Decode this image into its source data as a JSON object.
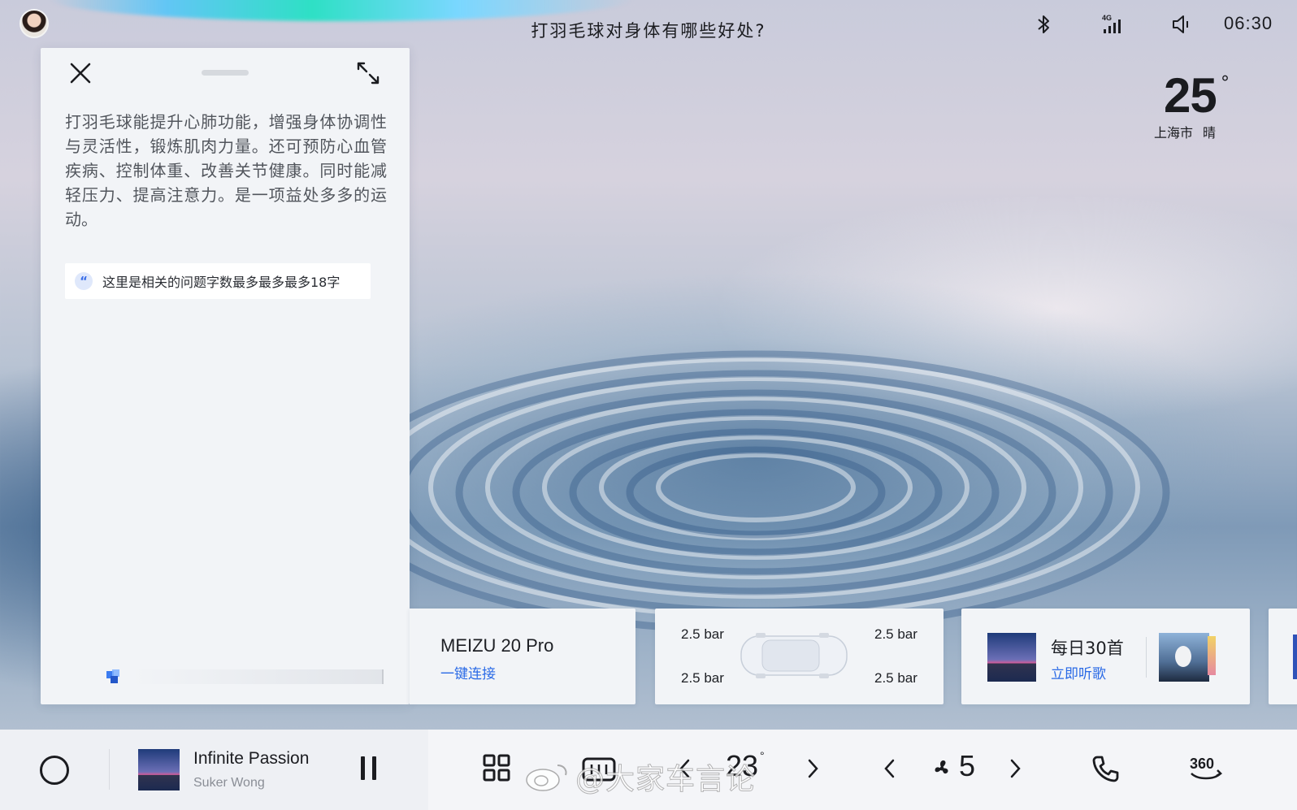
{
  "status_bar": {
    "query_title": "打羽毛球对身体有哪些好处?",
    "clock": "06:30",
    "icons": [
      "avatar",
      "bluetooth-icon",
      "signal-4g-icon",
      "volume-icon"
    ],
    "signal_label": "4G"
  },
  "weather": {
    "temperature": "25",
    "degree_symbol": "°",
    "city": "上海市",
    "condition": "晴"
  },
  "assistant_panel": {
    "answer_text": "打羽毛球能提升心肺功能，增强身体协调性与灵活性，锻炼肌肉力量。还可预防心血管疾病、控制体重、改善关节健康。同时能减轻压力、提高注意力。是一项益处多多的运动。",
    "related_question": "这里是相关的问题字数最多最多最多18字",
    "related_icon": "quote-icon"
  },
  "cards": {
    "phone": {
      "device_name": "MEIZU 20 Pro",
      "action": "一键连接"
    },
    "tire_pressure": {
      "front_left": "2.5 bar",
      "front_right": "2.5 bar",
      "rear_left": "2.5 bar",
      "rear_right": "2.5 bar"
    },
    "music": {
      "title": "每日30首",
      "action": "立即听歌"
    }
  },
  "dock": {
    "now_playing": {
      "title": "Infinite Passion",
      "artist": "Suker Wong"
    },
    "temperature": "23",
    "temperature_unit": "°",
    "fan_level": "5",
    "camera_label": "360"
  },
  "watermark": "@大家车言论",
  "colors": {
    "accent_blue": "#2a6ae6",
    "panel_bg": "#f2f4f7",
    "dock_bg": "#f4f5f8"
  }
}
